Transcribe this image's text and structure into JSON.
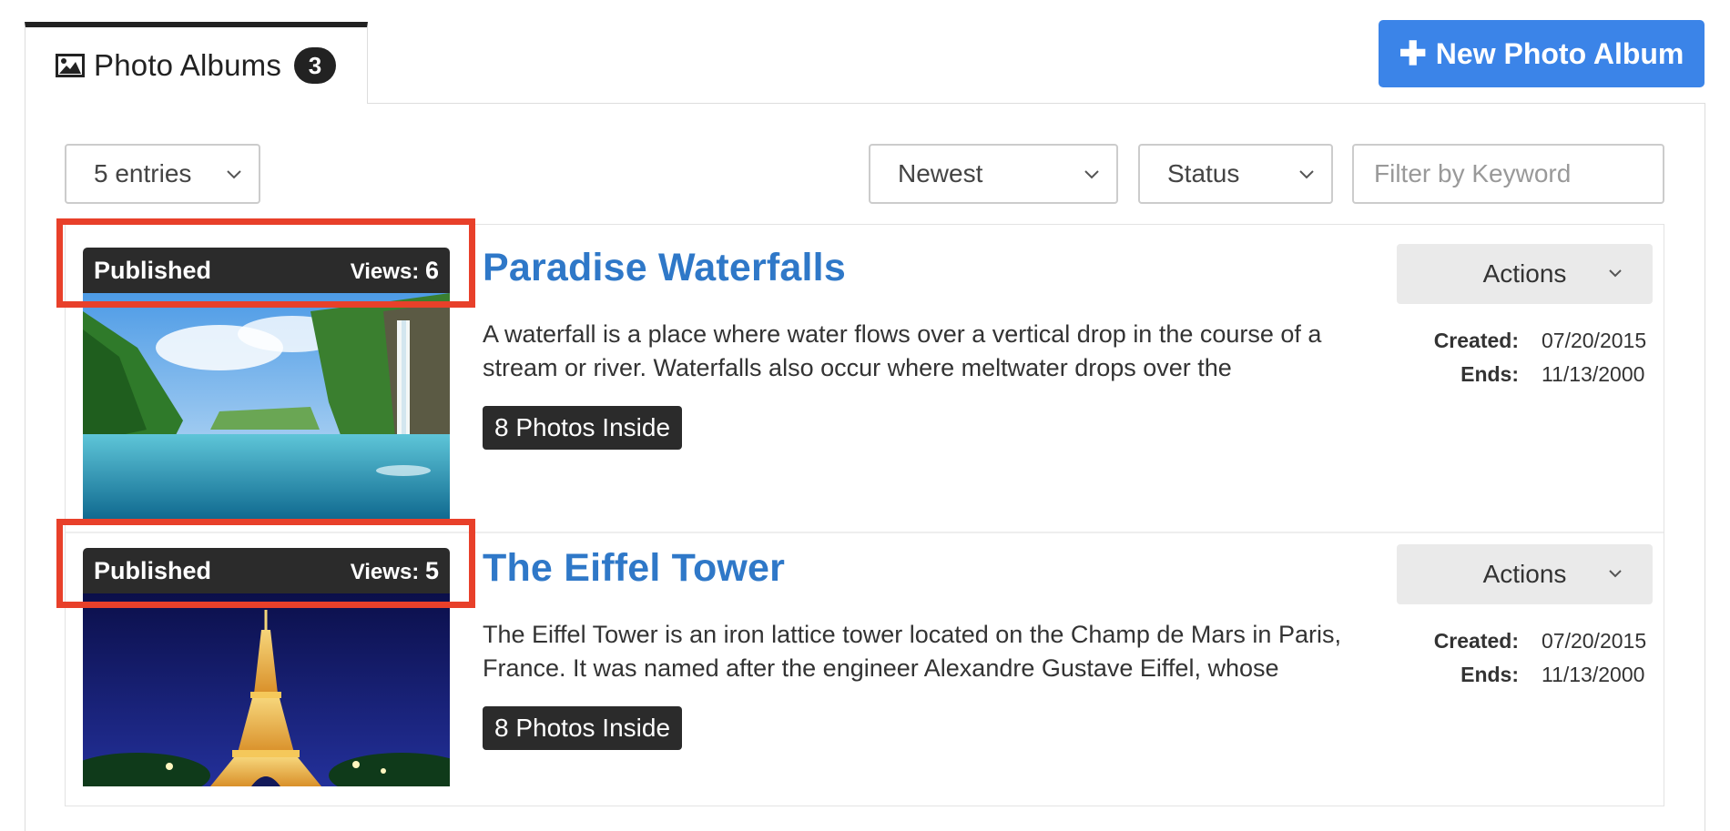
{
  "tab": {
    "title": "Photo Albums",
    "count": "3",
    "icon": "picture-icon"
  },
  "new_album_button": {
    "label": "New Photo Album",
    "icon": "plus-icon",
    "color": "#3b84e8"
  },
  "filters": {
    "entries": "5 entries",
    "sort": "Newest",
    "status": "Status",
    "keyword_placeholder": "Filter by Keyword"
  },
  "albums": [
    {
      "status": "Published",
      "views_label": "Views:",
      "views": "6",
      "title": "Paradise Waterfalls",
      "description": "A waterfall is a place where water flows over a vertical drop in the course of a stream or river. Waterfalls also occur where meltwater drops over the",
      "photos_badge": "8 Photos Inside",
      "actions_label": "Actions",
      "created_label": "Created:",
      "created": "07/20/2015",
      "ends_label": "Ends:",
      "ends": "11/13/2000"
    },
    {
      "status": "Published",
      "views_label": "Views:",
      "views": "5",
      "title": "The Eiffel Tower",
      "description": "The Eiffel Tower is an iron lattice tower located on the Champ de Mars in Paris, France. It was named after the engineer Alexandre Gustave Eiffel, whose",
      "photos_badge": "8 Photos Inside",
      "actions_label": "Actions",
      "created_label": "Created:",
      "created": "07/20/2015",
      "ends_label": "Ends:",
      "ends": "11/13/2000"
    }
  ],
  "colors": {
    "link": "#2f78c8",
    "highlight": "#e8402a",
    "dark": "#2b2b2b"
  }
}
